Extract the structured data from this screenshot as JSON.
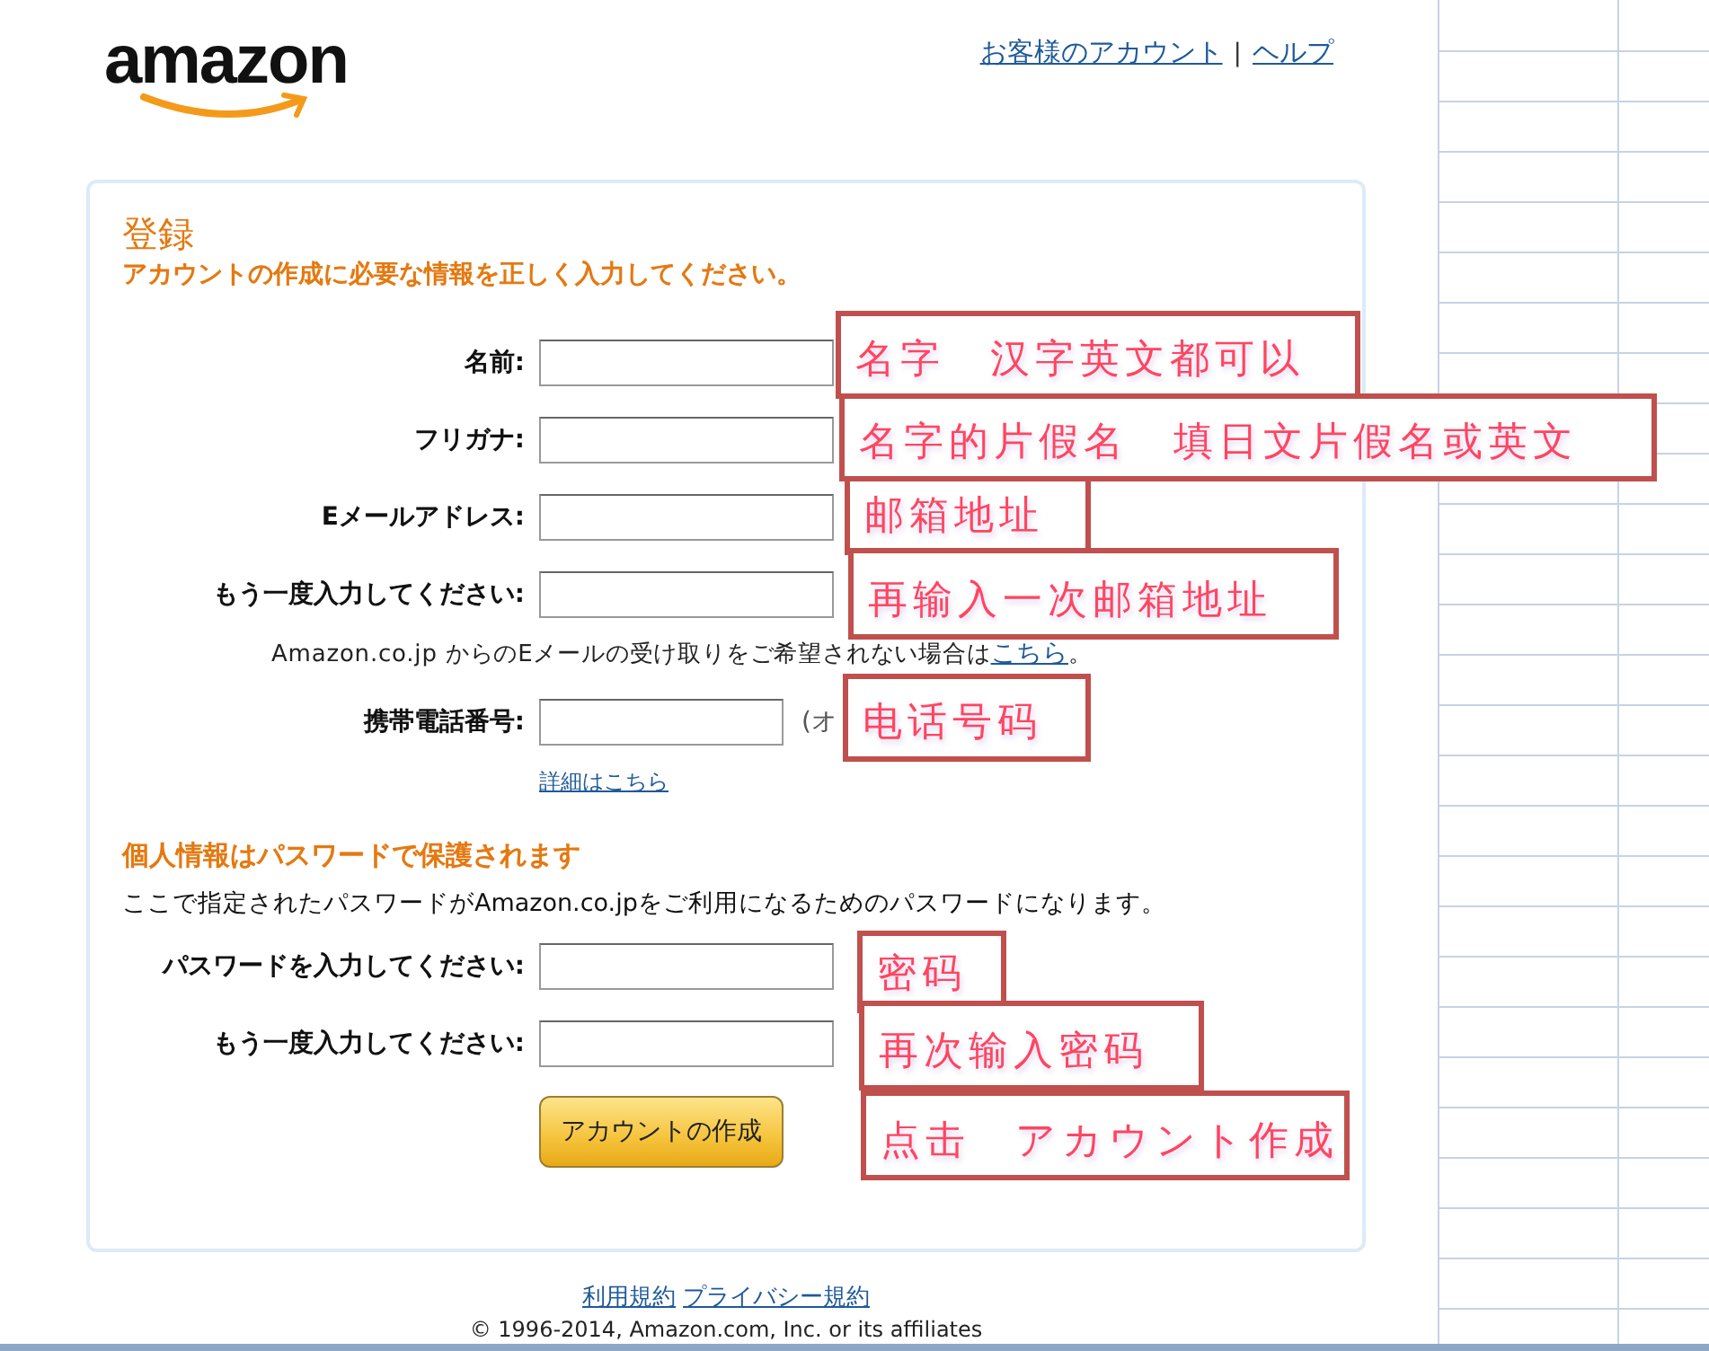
{
  "logo": "amazon",
  "header_links": [
    {
      "label": "お客様のアカウント"
    },
    {
      "label": "ヘルプ"
    }
  ],
  "header_separator": "|",
  "form": {
    "title": "登録",
    "subtitle": "アカウントの作成に必要な情報を正しく入力してください。",
    "rows": [
      {
        "kind": "field",
        "label": "名前:"
      },
      {
        "kind": "field",
        "label": "フリガナ:"
      },
      {
        "kind": "field",
        "label": "Eメールアドレス:"
      },
      {
        "kind": "field",
        "label": "もう一度入力してください:"
      },
      {
        "kind": "note",
        "text": "Amazon.co.jp からのEメールの受け取りをご希望されない場合は",
        "link": "こちら",
        "end": "。"
      },
      {
        "kind": "field",
        "label": "携帯電話番号:",
        "short": true,
        "hint": "(オ"
      },
      {
        "kind": "link",
        "text": "詳細はこちら"
      }
    ],
    "password_heading": "個人情報はパスワードで保護されます",
    "password_text": "ここで指定されたパスワードがAmazon.co.jpをご利用になるためのパスワードになります。",
    "password_fields": [
      {
        "label": "パスワードを入力してください:"
      },
      {
        "label": "もう一度入力してください:"
      }
    ],
    "submit": "アカウントの作成"
  },
  "footer_links": [
    {
      "label": "利用規約"
    },
    {
      "label": "プライバシー規約"
    }
  ],
  "copyright": "© 1996-2014, Amazon.com, Inc. or its affiliates",
  "annotations": [
    {
      "text": "名字　汉字英文都可以"
    },
    {
      "text": "名字的片假名　填日文片假名或英文"
    },
    {
      "text": "邮箱地址"
    },
    {
      "text": "再输入一次邮箱地址"
    },
    {
      "text": "电话号码"
    },
    {
      "text": "密码"
    },
    {
      "text": "再次输入密码"
    },
    {
      "text": "点击　アカウント作成"
    }
  ]
}
